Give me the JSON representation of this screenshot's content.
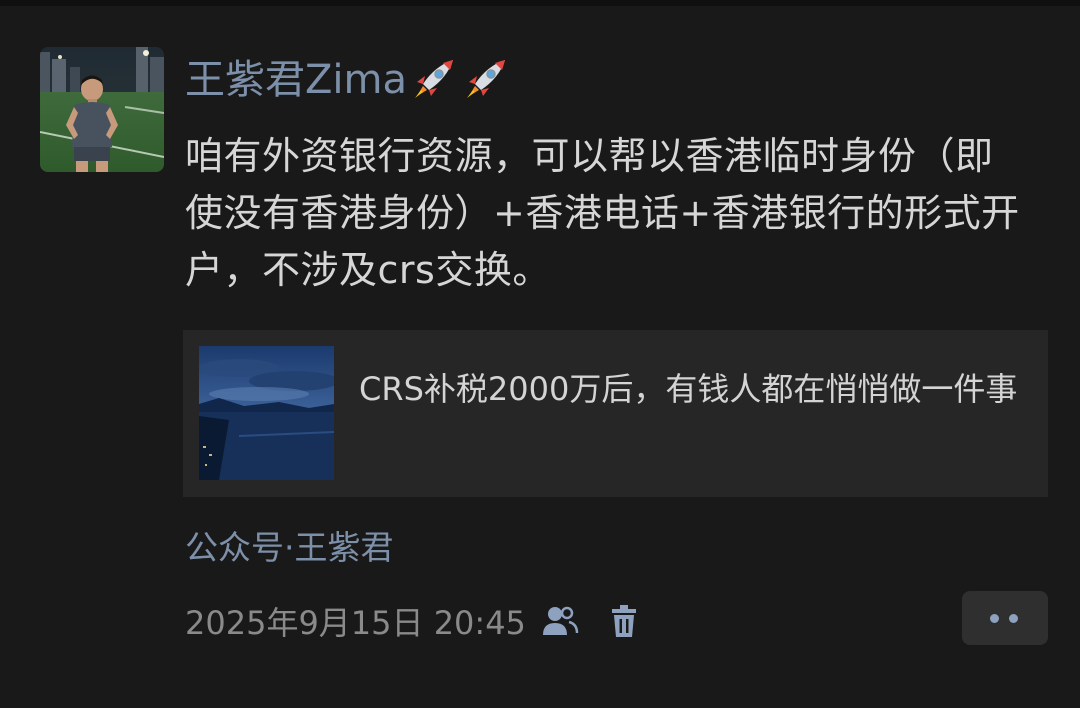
{
  "post": {
    "author": "王紫君Zima",
    "author_emoji": [
      "rocket-emoji",
      "rocket-emoji"
    ],
    "text": "咱有外资银行资源，可以帮以香港临时身份（即使没有香港身份）+香港电话+香港银行的形式开户，不涉及crs交换。",
    "link_card": {
      "title": "CRS补税2000万后，有钱人都在悄悄做一件事"
    },
    "source": "公众号·王紫君",
    "timestamp": "2025年9月15日 20:45",
    "icons": {
      "visibility": "friends-visibility-icon",
      "delete": "trash-icon",
      "more": "more-dots-icon"
    }
  },
  "colors": {
    "background": "#191919",
    "name": "#7d90a9",
    "text": "#d6d6d6",
    "card": "#262626",
    "meta": "#8a8a8a",
    "more_dots": "#8ea2c0"
  }
}
